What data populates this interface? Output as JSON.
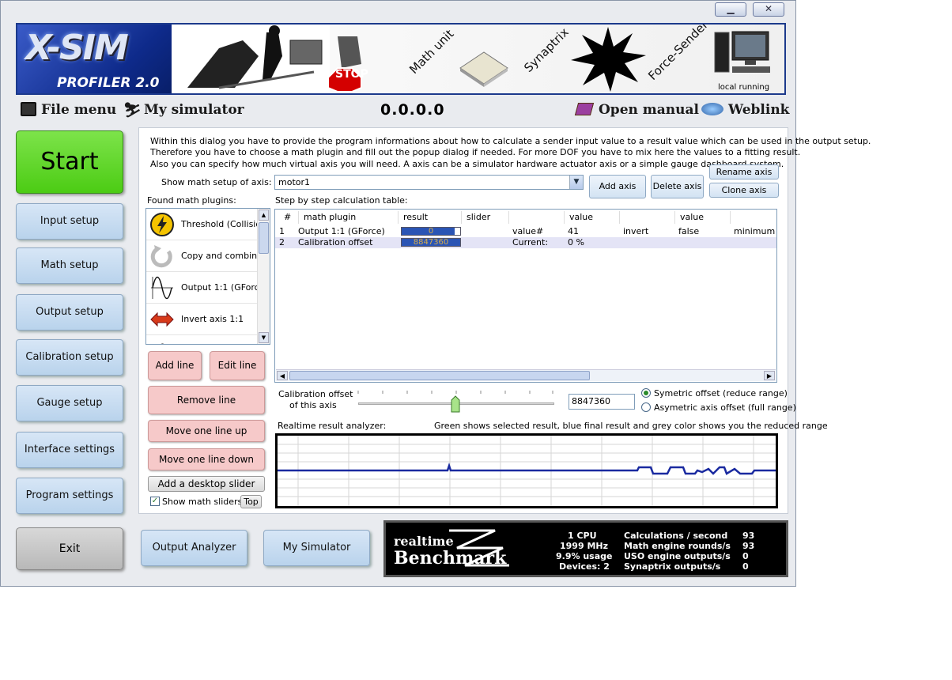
{
  "window": {
    "minimize_glyph": "▁",
    "close_glyph": "✕"
  },
  "banner": {
    "logo_main": "X-SIM",
    "logo_sub": "PROFILER 2.0",
    "stop_sign": "STOP",
    "math_unit": "Math unit",
    "synaptrix": "Synaptrix",
    "force_sender": "Force-Sender",
    "local_running": "local running"
  },
  "menu": {
    "file_menu": "File menu",
    "my_simulator": "My simulator",
    "version": "0.0.0.0",
    "open_manual": "Open manual",
    "weblink": "Weblink"
  },
  "sidebar": {
    "start": "Start",
    "items": [
      {
        "label": "Input setup"
      },
      {
        "label": "Math setup"
      },
      {
        "label": "Output setup"
      },
      {
        "label": "Calibration setup"
      },
      {
        "label": "Gauge setup"
      },
      {
        "label": "Interface settings"
      },
      {
        "label": "Program settings"
      }
    ],
    "exit": "Exit"
  },
  "bottom": {
    "output_analyzer": "Output Analyzer",
    "my_simulator": "My Simulator"
  },
  "main": {
    "info_line1": "Within this dialog you have to provide the program informations about how to calculate a sender input value to a result value which can be used in the output setup.",
    "info_line2": "Therefore you have to choose a math plugin and fill out the popup dialog if needed. For more DOF you have to mix here the values to a fitting result.",
    "info_line3": "Also you can specify how much virtual axis you will need. A axis can be a simulator hardware actuator axis or a simple gauge dashboard system.",
    "show_axis_label": "Show math setup of axis:",
    "axis_value": "motor1",
    "add_axis": "Add axis",
    "delete_axis": "Delete axis",
    "rename_axis": "Rename axis",
    "clone_axis": "Clone axis",
    "found_plugins_label": "Found math plugins:",
    "step_table_label": "Step by step calculation table:",
    "plugins": [
      {
        "name": "Threshold (Collision)",
        "icon": "lightning-icon"
      },
      {
        "name": "Copy and combine",
        "icon": "circular-arrow-icon"
      },
      {
        "name": "Output 1:1 (GForce)",
        "icon": "sine-wave-icon"
      },
      {
        "name": "Invert axis 1:1",
        "icon": "invert-arrows-icon"
      }
    ],
    "add_line": "Add line",
    "edit_line": "Edit line",
    "remove_line": "Remove line",
    "move_up": "Move one line up",
    "move_down": "Move one line down",
    "add_desktop_slider": "Add a desktop slider",
    "show_math_sliders": "Show math sliders",
    "top": "Top",
    "table": {
      "headers": [
        "#",
        "math plugin",
        "result",
        "slider",
        "",
        "value",
        "",
        "value"
      ],
      "rows": [
        {
          "num": "1",
          "plugin": "Output 1:1 (GForce)",
          "result": "0",
          "result_fraction": 0.9,
          "c4": "value#",
          "c5": "41",
          "c6": "invert",
          "c7": "false",
          "c8": "minimum"
        },
        {
          "num": "2",
          "plugin": "Calibration offset",
          "result": "8847360",
          "result_fraction": 1.0,
          "c4": "Current:",
          "c5": "0 %",
          "c6": "",
          "c7": "",
          "c8": ""
        }
      ]
    },
    "calib_label1": "Calibration offset",
    "calib_label2": "of this axis",
    "calib_value": "8847360",
    "symetric": "Symetric offset (reduce range)",
    "asymetric": "Asymetric axis offset (full range)",
    "analyzer_label": "Realtime result analyzer:",
    "analyzer_note": "Green shows selected result, blue final result and grey color shows you the reduced range"
  },
  "benchmark": {
    "logo_top": "realtime",
    "logo_bottom": "Benchmark",
    "cpu": "1 CPU",
    "mhz": "1999 MHz",
    "usage": "9.9% usage",
    "devices": "Devices: 2",
    "calc_label": "Calculations / second",
    "calc_value": "93",
    "rounds_label": "Math engine rounds/s",
    "rounds_value": "93",
    "uso_label": "USO engine outputs/s",
    "uso_value": "0",
    "syn_label": "Synaptrix outputs/s",
    "syn_value": "0"
  },
  "colors": {
    "start_green": "#4ccc14",
    "button_blue": "#c6dcf2",
    "button_pink": "#f6c9c9",
    "analyzer_line": "#1a2aa0"
  }
}
